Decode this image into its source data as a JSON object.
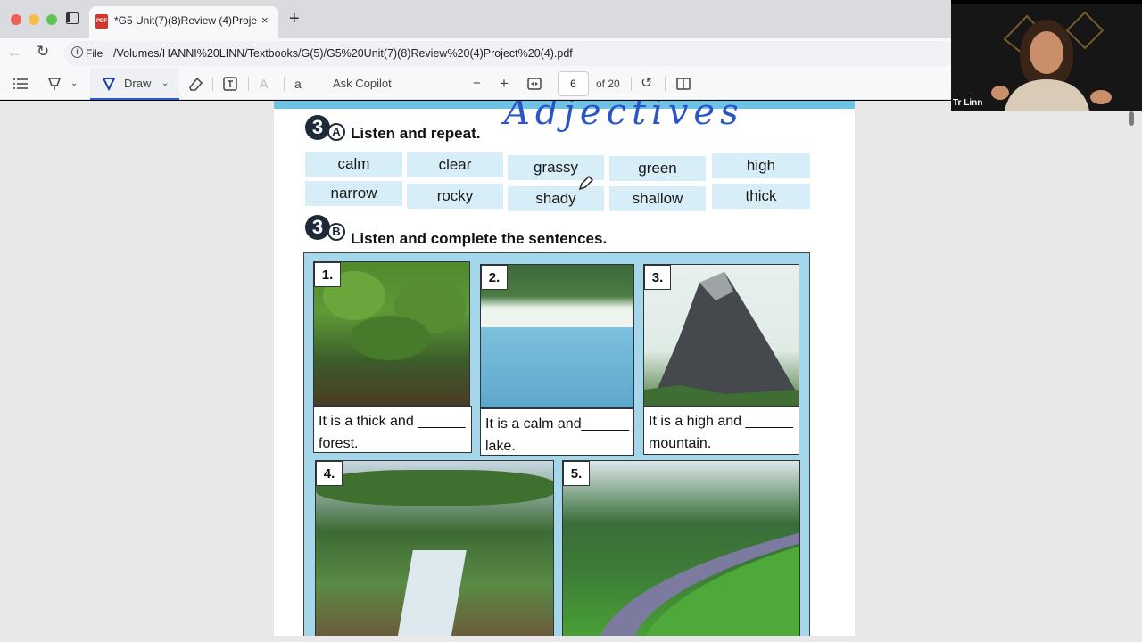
{
  "browser": {
    "tab_title": "*G5 Unit(7)(8)Review (4)Projec",
    "tab_close": "×",
    "new_tab": "+",
    "file_label": "File",
    "url": "/Volumes/HANNI%20LINN/Textbooks/G(5)/G5%20Unit(7)(8)Review%20(4)Project%20(4).pdf"
  },
  "toolbar": {
    "draw_label": "Draw",
    "ask_copilot": "Ask Copilot",
    "zoom_out": "−",
    "zoom_in": "+",
    "page_number": "6",
    "page_total": "of 20",
    "text_icon_label": "aあ",
    "read_aloud_label": "A"
  },
  "worksheet": {
    "handwritten_title": "Adjectives",
    "section_a": {
      "number": "3",
      "letter": "A",
      "title": "Listen and repeat."
    },
    "words_row1": [
      "calm",
      "clear",
      "grassy",
      "green",
      "high"
    ],
    "words_row2": [
      "narrow",
      "rocky",
      "shady",
      "shallow",
      "thick"
    ],
    "section_b": {
      "number": "3",
      "letter": "B",
      "title": "Listen and complete the sentences."
    },
    "pictures": [
      {
        "num": "1.",
        "line1": "It is a thick and ______",
        "line2": "forest."
      },
      {
        "num": "2.",
        "line1": "It is a calm and______",
        "line2": "lake."
      },
      {
        "num": "3.",
        "line1": "It is a high and ______",
        "line2": "mountain."
      },
      {
        "num": "4."
      },
      {
        "num": "5."
      }
    ]
  },
  "webcam": {
    "name": "Tr Linn"
  }
}
